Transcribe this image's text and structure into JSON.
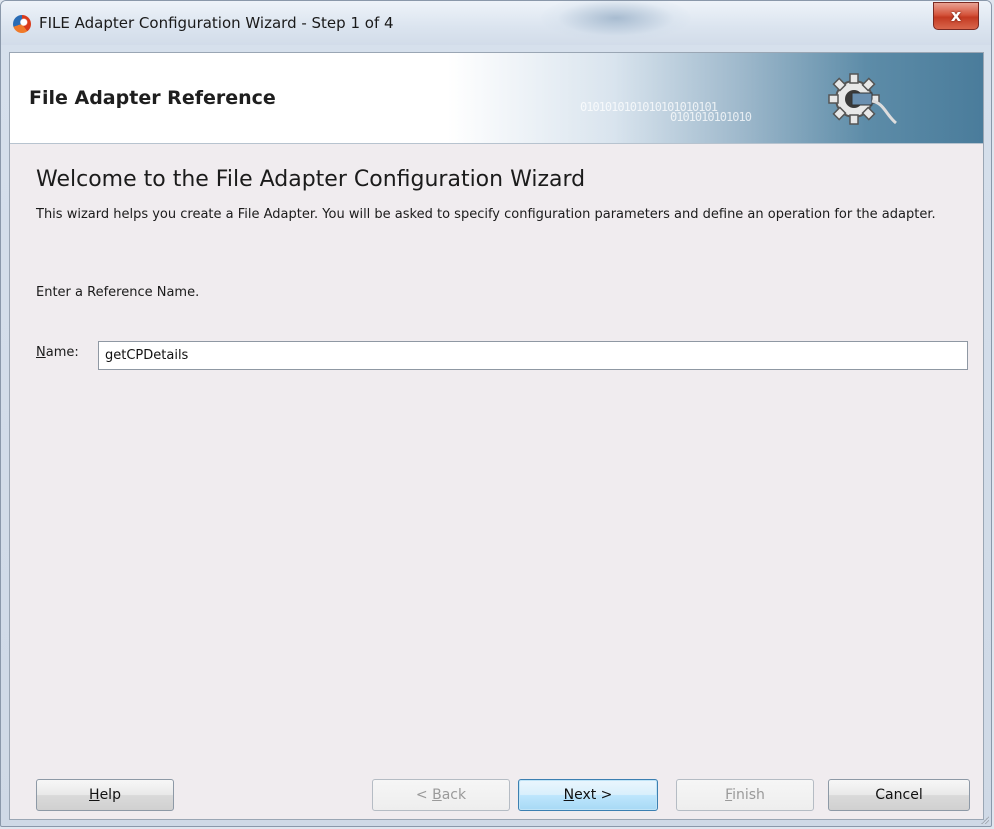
{
  "window": {
    "title": "FILE Adapter Configuration Wizard - Step 1 of 4",
    "close_label": "x"
  },
  "banner": {
    "title": "File Adapter Reference",
    "binary_line_1": "0101010101010101010101",
    "binary_line_2": "0101010101010"
  },
  "content": {
    "heading": "Welcome to the File Adapter Configuration Wizard",
    "description": "This wizard helps you create a File Adapter. You will be asked to specify configuration parameters and define an operation for the adapter.",
    "prompt": "Enter a Reference Name.",
    "name_label_mnemonic": "N",
    "name_label_rest": "ame:",
    "name_value": "getCPDetails"
  },
  "buttons": {
    "help_mnemonic": "H",
    "help_rest": "elp",
    "back_prefix": "< ",
    "back_mnemonic": "B",
    "back_rest": "ack",
    "next_mnemonic": "N",
    "next_rest": "ext >",
    "finish_mnemonic": "F",
    "finish_rest": "inish",
    "cancel": "Cancel"
  },
  "colors": {
    "client_background": "#f0ecef",
    "banner_accent": "#4a7c9b",
    "close_button": "#c33a22",
    "primary_button_border": "#3c7fb1"
  }
}
